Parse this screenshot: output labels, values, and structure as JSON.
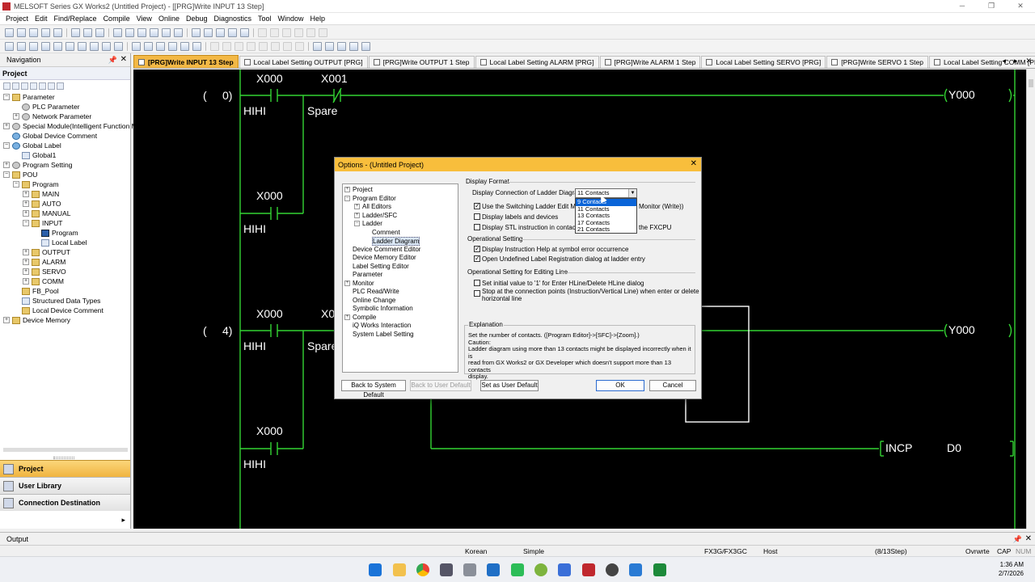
{
  "window": {
    "title": "MELSOFT Series GX Works2 (Untitled Project) - [[PRG]Write INPUT 13 Step]",
    "controls": [
      "─",
      "❐",
      "✕"
    ]
  },
  "menu": [
    "Project",
    "Edit",
    "Find/Replace",
    "Compile",
    "View",
    "Online",
    "Debug",
    "Diagnostics",
    "Tool",
    "Window",
    "Help"
  ],
  "nav": {
    "header": "Navigation",
    "sub": "Project",
    "tree": [
      {
        "label": "Parameter",
        "level": 0,
        "exp": "−",
        "icon": "folder"
      },
      {
        "label": "PLC Parameter",
        "level": 1,
        "exp": "",
        "icon": "gear"
      },
      {
        "label": "Network Parameter",
        "level": 1,
        "exp": "+",
        "icon": "gear"
      },
      {
        "label": "Special Module(Intelligent Function M",
        "level": 0,
        "exp": "+",
        "icon": "gear"
      },
      {
        "label": "Global Device Comment",
        "level": 0,
        "exp": "",
        "icon": "glob"
      },
      {
        "label": "Global Label",
        "level": 0,
        "exp": "−",
        "icon": "glob"
      },
      {
        "label": "Global1",
        "level": 1,
        "exp": "",
        "icon": "doc"
      },
      {
        "label": "Program Setting",
        "level": 0,
        "exp": "+",
        "icon": "gear"
      },
      {
        "label": "POU",
        "level": 0,
        "exp": "−",
        "icon": "folder"
      },
      {
        "label": "Program",
        "level": 1,
        "exp": "−",
        "icon": "folder"
      },
      {
        "label": "MAIN",
        "level": 2,
        "exp": "+",
        "icon": "folder"
      },
      {
        "label": "AUTO",
        "level": 2,
        "exp": "+",
        "icon": "folder"
      },
      {
        "label": "MANUAL",
        "level": 2,
        "exp": "+",
        "icon": "folder"
      },
      {
        "label": "INPUT",
        "level": 2,
        "exp": "−",
        "icon": "folder"
      },
      {
        "label": "Program",
        "level": 3,
        "exp": "",
        "icon": "sel"
      },
      {
        "label": "Local Label",
        "level": 3,
        "exp": "",
        "icon": "doc"
      },
      {
        "label": "OUTPUT",
        "level": 2,
        "exp": "+",
        "icon": "folder"
      },
      {
        "label": "ALARM",
        "level": 2,
        "exp": "+",
        "icon": "folder"
      },
      {
        "label": "SERVO",
        "level": 2,
        "exp": "+",
        "icon": "folder"
      },
      {
        "label": "COMM",
        "level": 2,
        "exp": "+",
        "icon": "folder"
      },
      {
        "label": "FB_Pool",
        "level": 1,
        "exp": "",
        "icon": "folder"
      },
      {
        "label": "Structured Data Types",
        "level": 1,
        "exp": "",
        "icon": "doc"
      },
      {
        "label": "Local Device Comment",
        "level": 1,
        "exp": "",
        "icon": "folder"
      },
      {
        "label": "Device Memory",
        "level": 0,
        "exp": "+",
        "icon": "folder"
      }
    ],
    "buttons": [
      "Project",
      "User Library",
      "Connection Destination"
    ],
    "more": "▸"
  },
  "tabs": [
    "[PRG]Write INPUT 13 Step",
    "Local Label Setting OUTPUT [PRG]",
    "[PRG]Write OUTPUT 1 Step",
    "Local Label Setting ALARM [PRG]",
    "[PRG]Write ALARM 1 Step",
    "Local Label Setting SERVO [PRG]",
    "[PRG]Write SERVO 1 Step",
    "Local Label Setting COMM [PRG]"
  ],
  "ladder": {
    "step0": "0)",
    "step4": "4)",
    "paren": "(",
    "x000": "X000",
    "x001": "X001",
    "x0partial": "X0",
    "hihi": "HIHI",
    "spare": "Spare",
    "y000": "Y000",
    "incp": "INCP",
    "d0": "D0"
  },
  "dialog": {
    "title": "Options - (Untitled Project)",
    "tree": [
      "Project",
      "Program Editor",
      "All Editors",
      "Ladder/SFC",
      "Ladder",
      "Comment",
      "Ladder Diagram",
      "Device Comment Editor",
      "Device Memory Editor",
      "Label Setting Editor",
      "Parameter",
      "Monitor",
      "PLC Read/Write",
      "Online Change",
      "Symbolic Information",
      "Compile",
      "iQ Works Interaction",
      "System Label Setting"
    ],
    "display_format": "Display Format",
    "connection_label": "Display Connection of Ladder Diagram",
    "connection_value": "11 Contacts",
    "dropdown": [
      "9 Contacts",
      "11 Contacts",
      "13 Contacts",
      "17 Contacts",
      "21 Contacts"
    ],
    "opt1a": "Use the Switching Ladder Edit Mode",
    "opt1b": "Monitor (Write))",
    "opt2": "Display labels and devices",
    "opt3a": "Display STL instruction in contact fo",
    "opt3b": "the FXCPU",
    "op_setting": "Operational Setting",
    "opt4": "Display Instruction Help at symbol error occurrence",
    "opt5": "Open Undefined Label Registration dialog at ladder entry",
    "op_edit": "Operational Setting for Editing Line",
    "opt6": "Set initial value to '1' for Enter HLine/Delete HLine dialog",
    "opt7": "Stop at the connection points (Instruction/Vertical Line) when enter or delete\nhorizontal line",
    "explanation_label": "Explanation",
    "explanation": "Set the number of contacts. ([Program Editor]->[SFC]->[Zoom].)\nCaution:\n Ladder diagram using more than 13 contacts might be displayed incorrectly when it is\n read from GX Works2 or GX Developer which doesn't support more than 13 contacts\n display.",
    "btn_system": "Back to System Default",
    "btn_user": "Back to User Default",
    "btn_set": "Set as User Default",
    "btn_ok": "OK",
    "btn_cancel": "Cancel"
  },
  "output": "Output",
  "status": {
    "lang": "Korean",
    "mode": "Simple",
    "cpu": "FX3G/FX3GC",
    "host": "Host",
    "step": "(8/13Step)",
    "ovr": "Ovrwrte",
    "cap": "CAP",
    "num": "NUM"
  },
  "clock": {
    "time": "1:36 AM",
    "date": "2/7/2026"
  },
  "colors": {
    "ladder_line": "#33d433",
    "accent": "#f3b845",
    "selection": "#0a64d8"
  }
}
